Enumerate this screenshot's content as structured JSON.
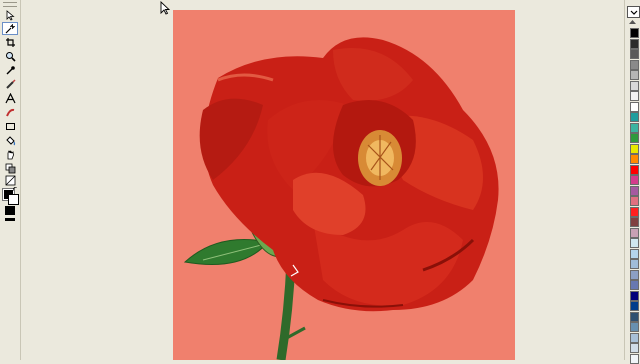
{
  "toolbox": {
    "tools": [
      {
        "name": "pick-tool-icon",
        "active": false
      },
      {
        "name": "shape-tool-icon",
        "active": true
      },
      {
        "name": "crop-tool-icon",
        "active": false
      },
      {
        "name": "zoom-tool-icon",
        "active": false
      },
      {
        "name": "eyedropper-tool-icon",
        "active": false
      },
      {
        "name": "paint-brush-tool-icon",
        "active": false
      },
      {
        "name": "text-tool-icon",
        "active": false
      },
      {
        "name": "smear-tool-icon",
        "active": false
      },
      {
        "name": "rectangle-tool-icon",
        "active": false
      },
      {
        "name": "fill-tool-icon",
        "active": false
      },
      {
        "name": "hand-tool-icon",
        "active": false
      },
      {
        "name": "clone-tool-icon",
        "active": false
      },
      {
        "name": "object-tool-icon",
        "active": false
      }
    ],
    "foreground_color": "#000000",
    "background_color": "#ffffff"
  },
  "canvas": {
    "background_color": "#f0806d",
    "image_subject": "red-rose-flower-icon"
  },
  "palette": {
    "colors": [
      "#000000",
      "#2b2b2b",
      "#5a5a5a",
      "#8a8a8a",
      "#b5b5b5",
      "#d8d8d8",
      "#f2f2f2",
      "#ffffff",
      "#1f9d9d",
      "#3cb4a0",
      "#2e9a3c",
      "#e8e800",
      "#ff8a00",
      "#ff0000",
      "#d43c8c",
      "#a55aa0",
      "#e07080",
      "#ff2020",
      "#804040",
      "#c8a0b4",
      "#d0e8f0",
      "#b4d4ec",
      "#a0bcd8",
      "#8ca0c4",
      "#6878b0",
      "#00007a",
      "#003c8c",
      "#305070",
      "#6890b0",
      "#a8c0d8",
      "#d0dce8",
      "#f0f4f8"
    ]
  }
}
